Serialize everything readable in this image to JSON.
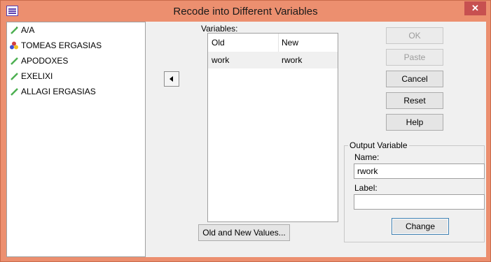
{
  "window": {
    "title": "Recode into Different Variables"
  },
  "source_variables": [
    {
      "label": "A/A",
      "icon": "scale-ruler-icon",
      "color": "#4caf50"
    },
    {
      "label": "TOMEAS ERGASIAS",
      "icon": "nominal-balls-icon",
      "color": "#d23f3f"
    },
    {
      "label": "APODOXES",
      "icon": "scale-ruler-icon",
      "color": "#4caf50"
    },
    {
      "label": "EXELIXI",
      "icon": "scale-ruler-icon",
      "color": "#4caf50"
    },
    {
      "label": "ALLAGI ERGASIAS",
      "icon": "scale-ruler-icon",
      "color": "#4caf50"
    }
  ],
  "variables": {
    "label": "Variables:",
    "columns": [
      "Old",
      "New"
    ],
    "rows": [
      {
        "old": "work",
        "new": "rwork"
      }
    ]
  },
  "buttons": {
    "ok": "OK",
    "paste": "Paste",
    "cancel": "Cancel",
    "reset": "Reset",
    "help": "Help",
    "old_new_values": "Old and New Values...",
    "change": "Change"
  },
  "output_variable": {
    "title": "Output Variable",
    "name_label": "Name:",
    "name_value": "rwork",
    "label_label": "Label:",
    "label_value": ""
  }
}
